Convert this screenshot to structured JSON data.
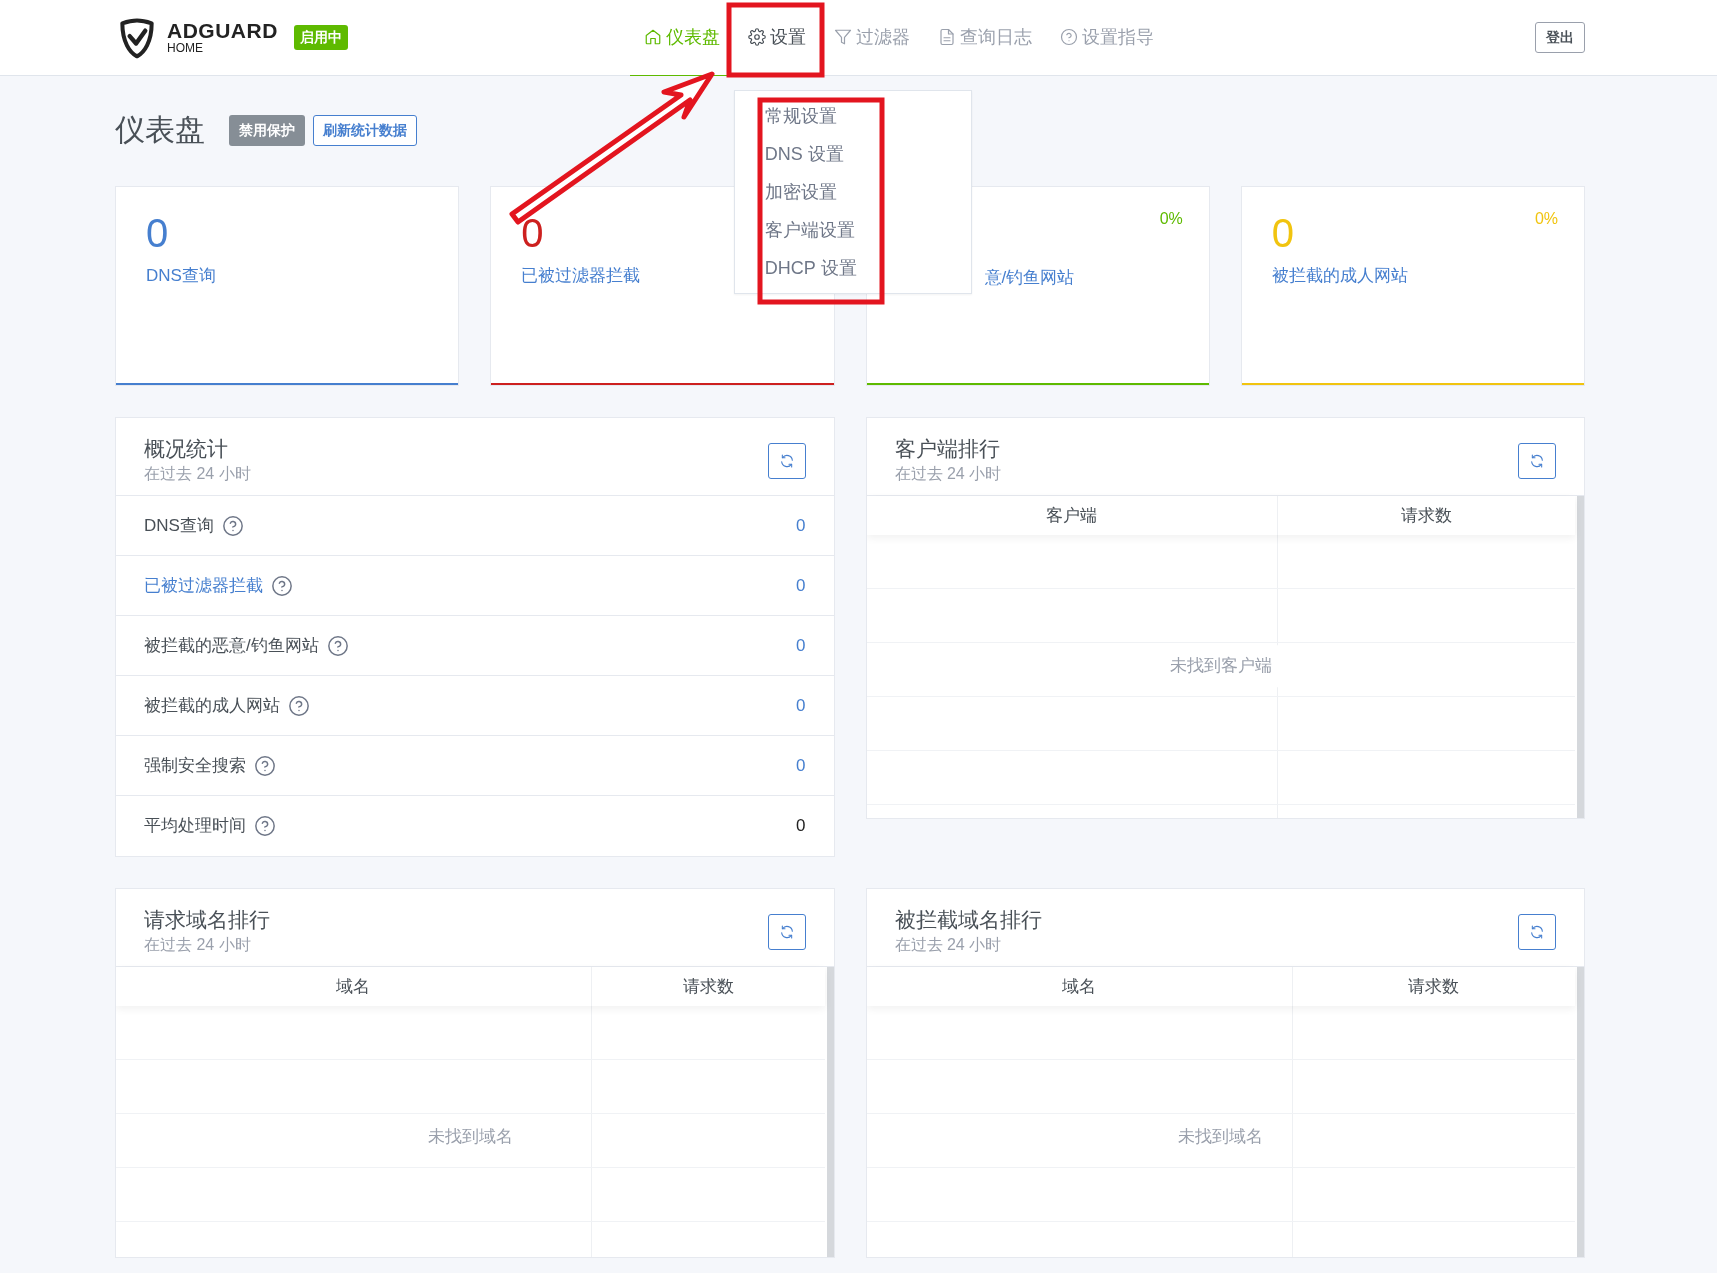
{
  "header": {
    "logo": {
      "title": "ADGUARD",
      "subtitle": "HOME"
    },
    "status_badge": "启用中",
    "nav": [
      {
        "label": "仪表盘",
        "selected": true,
        "expanded": false
      },
      {
        "label": "设置",
        "selected": false,
        "expanded": true
      },
      {
        "label": "过滤器",
        "selected": false,
        "expanded": false
      },
      {
        "label": "查询日志",
        "selected": false,
        "expanded": false
      },
      {
        "label": "设置指导",
        "selected": false,
        "expanded": false
      }
    ],
    "logout": "登出"
  },
  "settings_menu": {
    "items": [
      "常规设置",
      "DNS 设置",
      "加密设置",
      "客户端设置",
      "DHCP 设置"
    ]
  },
  "page": {
    "title": "仪表盘",
    "buttons": [
      {
        "label": "禁用保护",
        "kind": "secondary"
      },
      {
        "label": "刷新统计数据",
        "kind": "outline"
      }
    ]
  },
  "counters": [
    {
      "value": "0",
      "label": "DNS查询",
      "color": "#467fcf"
    },
    {
      "value": "0",
      "label": "已被过滤器拦截",
      "color": "#cd201f"
    },
    {
      "percent": "0%",
      "label": "意/钓鱼网站",
      "color": "#5eba00",
      "kind": "covered"
    },
    {
      "value": "0",
      "percent": "0%",
      "label": "被拦截的成人网站",
      "color": "#f1c40f"
    }
  ],
  "stats": {
    "title": "概况统计",
    "subtitle": "在过去 24 小时",
    "rows": [
      {
        "label": "DNS查询",
        "value": "0",
        "label_link": false,
        "value_link": true
      },
      {
        "label": "已被过滤器拦截",
        "value": "0",
        "label_link": true,
        "value_link": true
      },
      {
        "label": "被拦截的恶意/钓鱼网站",
        "value": "0",
        "label_link": false,
        "value_link": true
      },
      {
        "label": "被拦截的成人网站",
        "value": "0",
        "label_link": false,
        "value_link": true
      },
      {
        "label": "强制安全搜索",
        "value": "0",
        "label_link": false,
        "value_link": true
      },
      {
        "label": "平均处理时间",
        "value": "0",
        "label_link": false,
        "value_link": false
      }
    ]
  },
  "clients": {
    "title": "客户端排行",
    "subtitle": "在过去 24 小时",
    "columns": [
      "客户端",
      "请求数"
    ],
    "empty_text": "未找到客户端"
  },
  "top_domains": {
    "title": "请求域名排行",
    "subtitle": "在过去 24 小时",
    "columns": [
      "域名",
      "请求数"
    ],
    "empty_text": "未找到域名"
  },
  "blocked_domains": {
    "title": "被拦截域名排行",
    "subtitle": "在过去 24 小时",
    "columns": [
      "域名",
      "请求数"
    ],
    "empty_text": "未找到域名"
  }
}
